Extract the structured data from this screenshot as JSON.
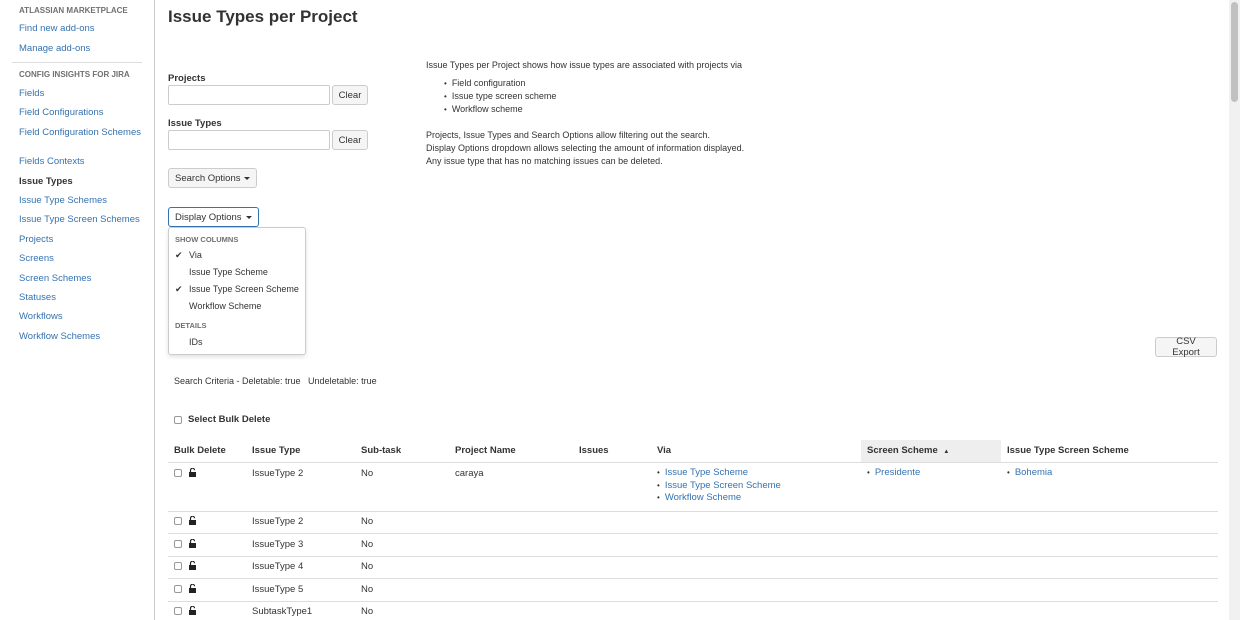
{
  "sidebar": {
    "section1_title": "ATLASSIAN MARKETPLACE",
    "section1_items": [
      "Find new add-ons",
      "Manage add-ons"
    ],
    "section2_title": "CONFIG INSIGHTS FOR JIRA",
    "section2_items": [
      "Fields",
      "Field Configurations",
      "Field Configuration Schemes",
      "Fields Contexts",
      "Issue Types",
      "Issue Type Schemes",
      "Issue Type Screen Schemes",
      "Projects",
      "Screens",
      "Screen Schemes",
      "Statuses",
      "Workflows",
      "Workflow Schemes"
    ],
    "active_item": "Issue Types"
  },
  "page": {
    "title": "Issue Types per Project"
  },
  "filters": {
    "projects_label": "Projects",
    "projects_value": "",
    "issue_types_label": "Issue Types",
    "issue_types_value": "",
    "clear_label": "Clear",
    "search_options_label": "Search Options",
    "display_options_label": "Display Options"
  },
  "info": {
    "intro": "Issue Types per Project shows how issue types are associated with projects via",
    "bullets": [
      "Field configuration",
      "Issue type screen scheme",
      "Workflow scheme"
    ],
    "line1": "Projects, Issue Types and Search Options allow filtering out the search.",
    "line2": "Display Options dropdown allows selecting the amount of information displayed.",
    "line3": "Any issue type that has no matching issues can be deleted."
  },
  "display_menu": {
    "show_columns_heading": "SHOW COLUMNS",
    "columns": [
      {
        "label": "Via",
        "checked": true
      },
      {
        "label": "Issue Type Scheme",
        "checked": false
      },
      {
        "label": "Issue Type Screen Scheme",
        "checked": true
      },
      {
        "label": "Workflow Scheme",
        "checked": false
      }
    ],
    "details_heading": "DETAILS",
    "details": [
      {
        "label": "IDs",
        "checked": false
      }
    ]
  },
  "csv_export_label": "CSV Export",
  "search_criteria": "Search Criteria - Deletable: true   Undeletable: true",
  "select_bulk_delete_label": "Select Bulk Delete",
  "table": {
    "headers": {
      "bulk_delete": "Bulk Delete",
      "issue_type": "Issue Type",
      "sub_task": "Sub-task",
      "project_name": "Project Name",
      "issues": "Issues",
      "via": "Via",
      "screen_scheme": "Screen Scheme",
      "issue_type_screen_scheme": "Issue Type Screen Scheme"
    },
    "sort_indicator": "▲",
    "rows": [
      {
        "issue_type": "IssueType 2",
        "sub_task": "No",
        "project_name": "caraya",
        "issues": "",
        "via": [
          "Issue Type Scheme",
          "Issue Type Screen Scheme",
          "Workflow Scheme"
        ],
        "screen_scheme": "Presidente",
        "issue_type_screen_scheme": "Bohemia"
      },
      {
        "issue_type": "IssueType 2",
        "sub_task": "No"
      },
      {
        "issue_type": "IssueType 3",
        "sub_task": "No"
      },
      {
        "issue_type": "IssueType 4",
        "sub_task": "No"
      },
      {
        "issue_type": "IssueType 5",
        "sub_task": "No"
      },
      {
        "issue_type": "SubtaskType1",
        "sub_task": "No"
      }
    ]
  },
  "colors": {
    "link": "#3572b0",
    "text": "#333333",
    "sorted_header_bg": "#eeeeee"
  }
}
